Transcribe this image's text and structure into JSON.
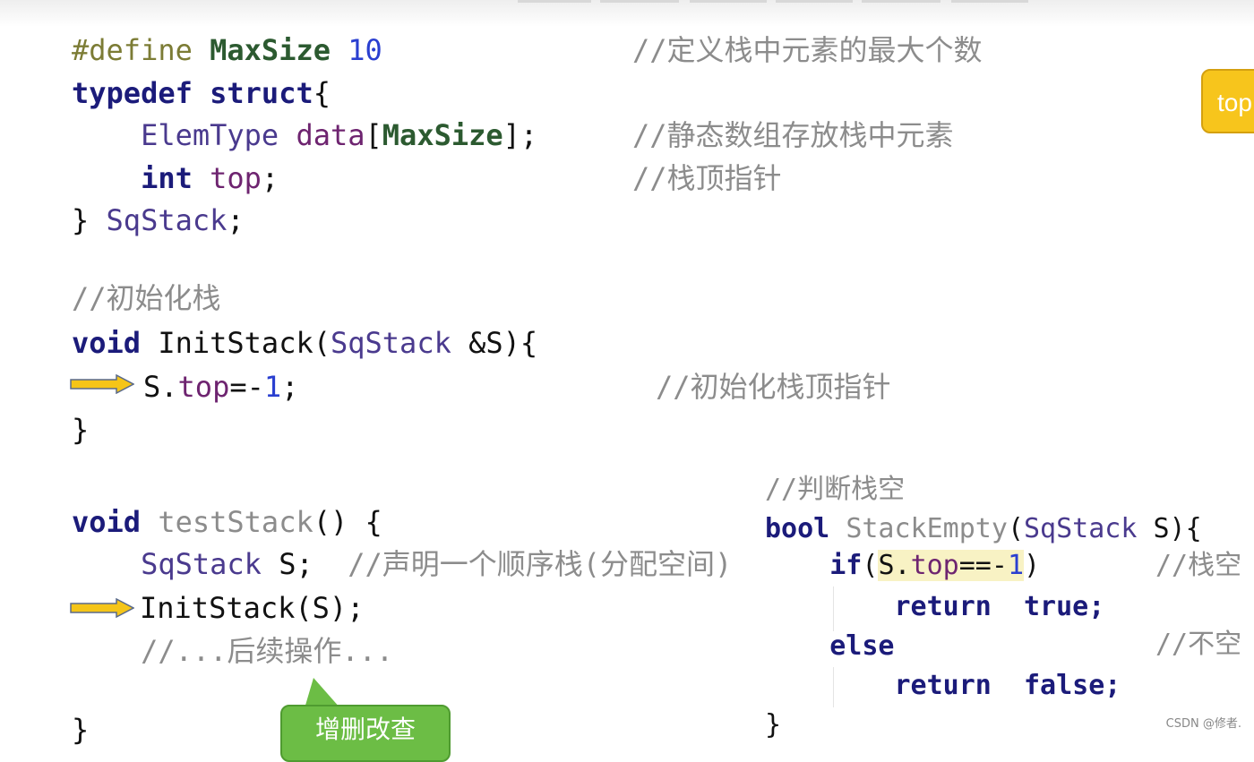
{
  "left_code": [
    [
      {
        "t": "#define ",
        "c": "pp"
      },
      {
        "t": "MaxSize ",
        "c": "mac"
      },
      {
        "t": "10",
        "c": "num"
      }
    ],
    [
      {
        "t": "typedef ",
        "c": "kw"
      },
      {
        "t": "struct",
        "c": "kw"
      },
      {
        "t": "{",
        "c": "pl"
      }
    ],
    [
      {
        "t": "    ElemType ",
        "c": "ty"
      },
      {
        "t": "data",
        "c": "fld"
      },
      {
        "t": "[",
        "c": "pl"
      },
      {
        "t": "MaxSize",
        "c": "mac"
      },
      {
        "t": "];",
        "c": "pl"
      }
    ],
    [
      {
        "t": "    int ",
        "c": "kw"
      },
      {
        "t": "top",
        "c": "fld"
      },
      {
        "t": ";",
        "c": "pl"
      }
    ],
    [
      {
        "t": "} ",
        "c": "pl"
      },
      {
        "t": "SqStack",
        "c": "ty"
      },
      {
        "t": ";",
        "c": "pl"
      }
    ],
    [
      {
        "t": "//初始化栈",
        "c": "cm"
      }
    ],
    [
      {
        "t": "void ",
        "c": "kw"
      },
      {
        "t": "InitStack",
        "c": "pl"
      },
      {
        "t": "(",
        "c": "pl"
      },
      {
        "t": "SqStack ",
        "c": "ty"
      },
      {
        "t": "&S){",
        "c": "pl"
      }
    ],
    [
      {
        "t": "S.",
        "c": "pl"
      },
      {
        "t": "top",
        "c": "fld"
      },
      {
        "t": "=-",
        "c": "pl"
      },
      {
        "t": "1",
        "c": "num"
      },
      {
        "t": ";",
        "c": "pl"
      }
    ],
    [
      {
        "t": "}",
        "c": "pl"
      }
    ],
    [
      {
        "t": "void ",
        "c": "kw"
      },
      {
        "t": "testStack",
        "c": "fn"
      },
      {
        "t": "() {",
        "c": "pl"
      }
    ],
    [
      {
        "t": "    SqStack ",
        "c": "ty"
      },
      {
        "t": "S;  ",
        "c": "pl"
      },
      {
        "t": "//声明一个顺序栈(分配空间)",
        "c": "cm"
      }
    ],
    [
      {
        "t": "InitStack(S);",
        "c": "pl"
      }
    ],
    [
      {
        "t": "    //...后续操作...",
        "c": "cm"
      }
    ],
    [
      {
        "t": "}",
        "c": "pl"
      }
    ]
  ],
  "left_comments": [
    "//定义栈中元素的最大个数",
    "//静态数组存放栈中元素",
    "//栈顶指针",
    "//初始化栈顶指针"
  ],
  "right_code": [
    [
      {
        "t": "//判断栈空",
        "c": "cm"
      }
    ],
    [
      {
        "t": "bool ",
        "c": "kw"
      },
      {
        "t": "StackEmpty",
        "c": "fn"
      },
      {
        "t": "(",
        "c": "pl"
      },
      {
        "t": "SqStack ",
        "c": "ty"
      },
      {
        "t": "S){",
        "c": "pl"
      }
    ],
    [
      {
        "t": "    if",
        "c": "kw"
      },
      {
        "t": "(",
        "c": "pl"
      },
      {
        "t": "S.",
        "c": "pl hl"
      },
      {
        "t": "top",
        "c": "fld hl"
      },
      {
        "t": "==-",
        "c": "pl hl"
      },
      {
        "t": "1",
        "c": "num hl"
      },
      {
        "t": ")",
        "c": "pl"
      }
    ],
    [
      {
        "t": "        return  true;",
        "c": "kw"
      }
    ],
    [
      {
        "t": "    else",
        "c": "kw"
      }
    ],
    [
      {
        "t": "        return  false;",
        "c": "kw"
      }
    ],
    [
      {
        "t": "}",
        "c": "pl"
      }
    ]
  ],
  "right_comments": [
    "//栈空",
    "//不空"
  ],
  "top_note": "top",
  "callout": "增删改查",
  "watermark": "CSDN @修者.",
  "colors": {
    "arrow": "#f5c518",
    "callout": "#6cbd45",
    "note": "#f7c51c"
  }
}
